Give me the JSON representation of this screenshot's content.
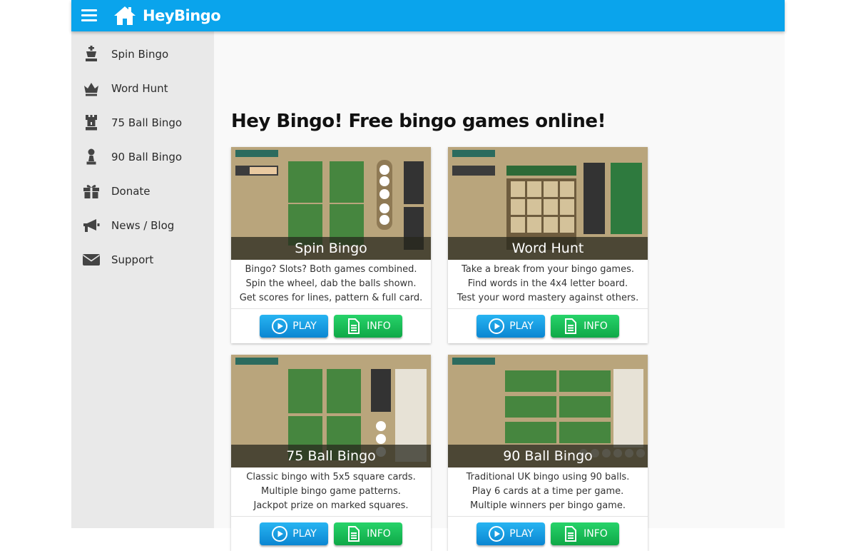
{
  "header": {
    "brand": "HeyBingo",
    "menu_icon": "hamburger-menu-icon",
    "brand_icon": "home-icon",
    "bar_color": "#0aa4ec"
  },
  "sidebar": {
    "items": [
      {
        "label": "Spin Bingo",
        "icon": "chess-king-icon"
      },
      {
        "label": "Word Hunt",
        "icon": "crown-icon"
      },
      {
        "label": "75 Ball Bingo",
        "icon": "chess-rook-icon"
      },
      {
        "label": "90 Ball Bingo",
        "icon": "chess-pawn-icon"
      },
      {
        "label": "Donate",
        "icon": "gift-icon"
      },
      {
        "label": "News / Blog",
        "icon": "megaphone-icon"
      },
      {
        "label": "Support",
        "icon": "envelope-icon"
      }
    ]
  },
  "main": {
    "title": "Hey Bingo! Free bingo games online!"
  },
  "games": [
    {
      "name": "Spin Bingo",
      "lines": [
        "Bingo? Slots? Both games combined.",
        "Spin the wheel, dab the balls shown.",
        "Get scores for lines, pattern & full card."
      ],
      "play": "PLAY",
      "info": "INFO"
    },
    {
      "name": "Word Hunt",
      "lines": [
        "Take a break from your bingo games.",
        "Find words in the 4x4 letter board.",
        "Test your word mastery against others."
      ],
      "play": "PLAY",
      "info": "INFO"
    },
    {
      "name": "75 Ball Bingo",
      "lines": [
        "Classic bingo with 5x5 square cards.",
        "Multiple bingo game patterns.",
        "Jackpot prize on marked squares."
      ],
      "play": "PLAY",
      "info": "INFO"
    },
    {
      "name": "90 Ball Bingo",
      "lines": [
        "Traditional UK bingo using 90 balls.",
        "Play 6 cards at a time per game.",
        "Multiple winners per bingo game."
      ],
      "play": "PLAY",
      "info": "INFO"
    }
  ],
  "colors": {
    "play_button": "#0b86d2",
    "info_button": "#0fa847",
    "sidebar_bg": "#e9e9e9"
  }
}
